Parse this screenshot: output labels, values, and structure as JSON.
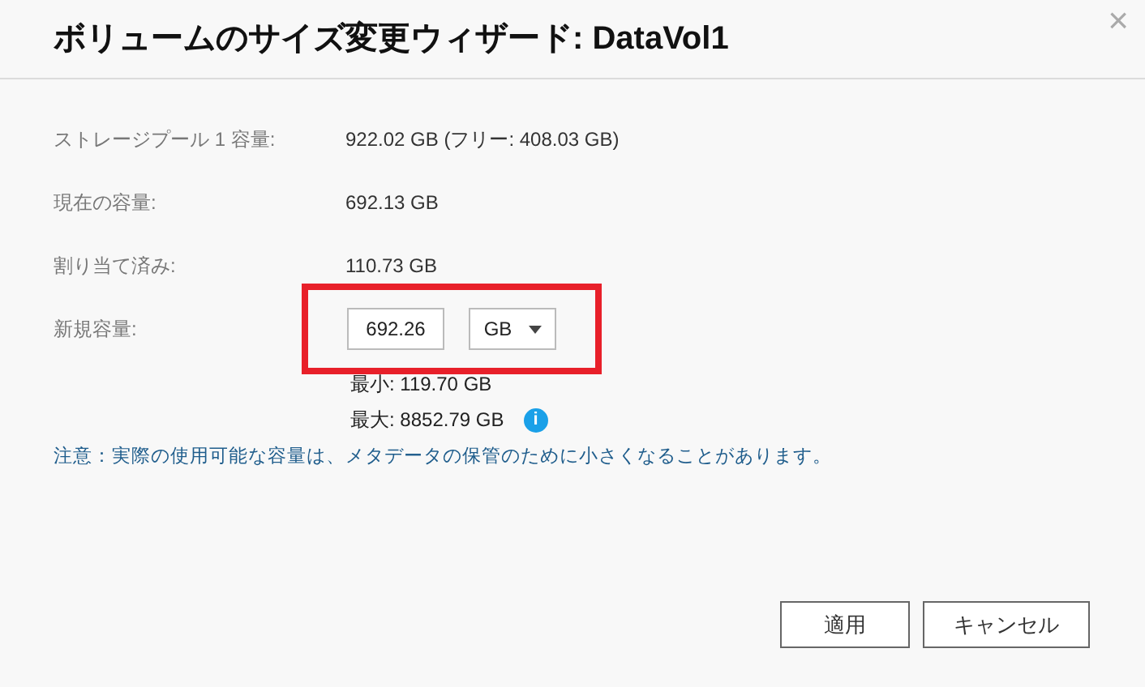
{
  "dialog": {
    "title": "ボリュームのサイズ変更ウィザード: DataVol1",
    "close": "×"
  },
  "info_rows": [
    {
      "label": "ストレージプール 1 容量:",
      "value": "922.02 GB (フリー: 408.03 GB)"
    },
    {
      "label": "現在の容量:",
      "value": "692.13 GB"
    },
    {
      "label": "割り当て済み:",
      "value": "110.73 GB"
    }
  ],
  "new_capacity": {
    "label": "新規容量:",
    "value": "692.26",
    "unit": "GB",
    "highlighted": true,
    "min": "最小: 119.70 GB",
    "max": "最大: 8852.79 GB",
    "info": "i"
  },
  "note": "注意：実際の使用可能な容量は、メタデータの保管のために小さくなることがあります。",
  "buttons": [
    "適用",
    "キャンセル"
  ]
}
